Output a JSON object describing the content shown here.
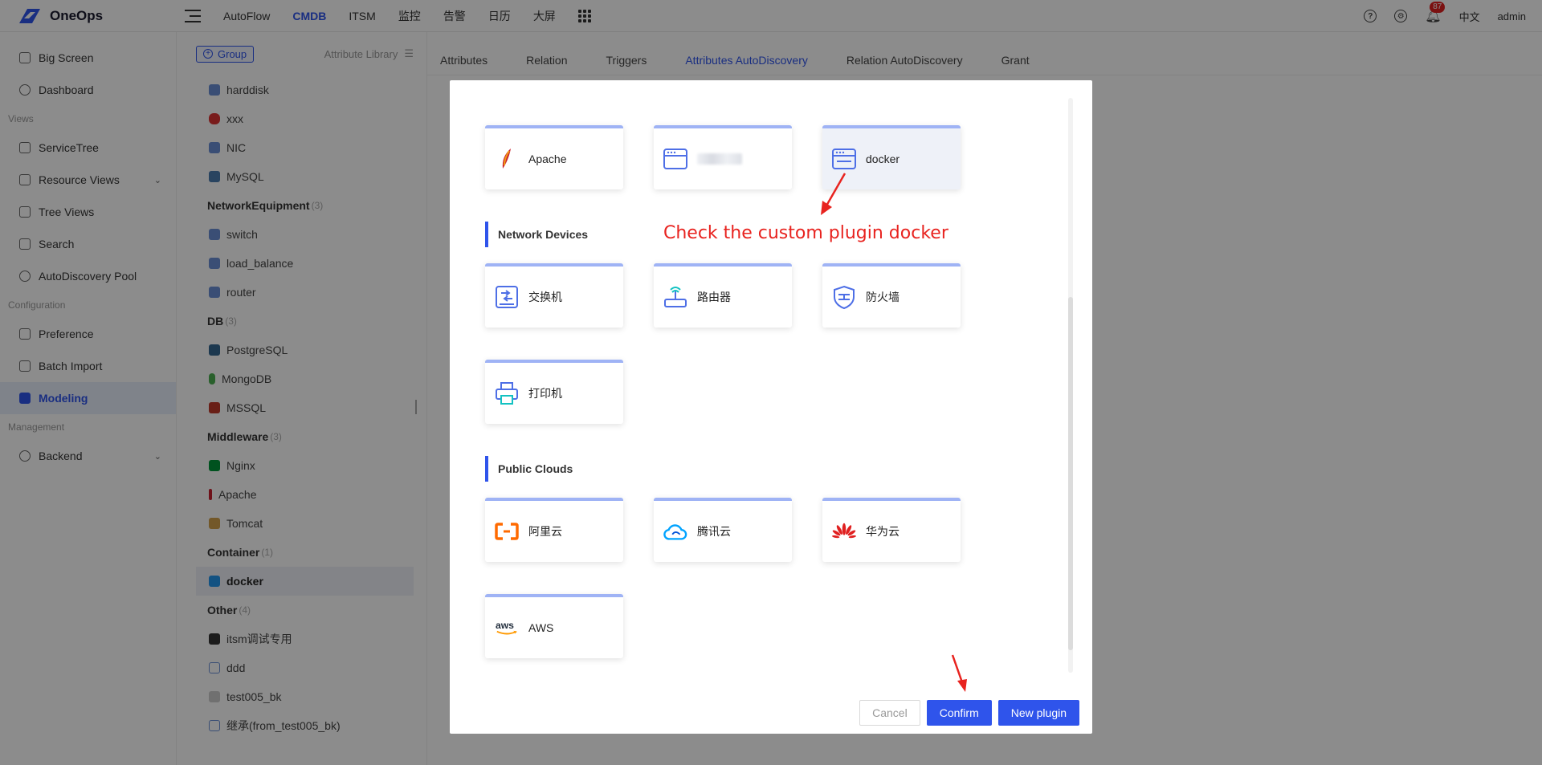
{
  "app": {
    "title": "OneOps"
  },
  "topnav": {
    "items": [
      "AutoFlow",
      "CMDB",
      "ITSM",
      "监控",
      "告警",
      "日历",
      "大屏"
    ],
    "active": "CMDB",
    "notification_count": "87",
    "language": "中文",
    "user": "admin"
  },
  "sidebar": {
    "items": [
      {
        "label": "Big Screen"
      },
      {
        "label": "Dashboard"
      }
    ],
    "group_views": "Views",
    "views_items": [
      {
        "label": "ServiceTree"
      },
      {
        "label": "Resource Views"
      },
      {
        "label": "Tree Views"
      },
      {
        "label": "Search"
      },
      {
        "label": "AutoDiscovery Pool"
      }
    ],
    "group_configuration": "Configuration",
    "config_items": [
      {
        "label": "Preference"
      },
      {
        "label": "Batch Import"
      },
      {
        "label": "Modeling"
      }
    ],
    "group_management": "Management",
    "management_items": [
      {
        "label": "Backend"
      }
    ]
  },
  "models": {
    "group_button": "Group",
    "attribute_library": "Attribute Library",
    "top_items": [
      "harddisk",
      "xxx",
      "NIC",
      "MySQL"
    ],
    "groups": [
      {
        "name": "NetworkEquipment",
        "count": "(3)",
        "items": [
          "switch",
          "load_balance",
          "router"
        ]
      },
      {
        "name": "DB",
        "count": "(3)",
        "items": [
          "PostgreSQL",
          "MongoDB",
          "MSSQL"
        ]
      },
      {
        "name": "Middleware",
        "count": "(3)",
        "items": [
          "Nginx",
          "Apache",
          "Tomcat"
        ]
      },
      {
        "name": "Container",
        "count": "(1)",
        "items": [
          "docker"
        ]
      },
      {
        "name": "Other",
        "count": "(4)",
        "items": [
          "itsm调试专用",
          "ddd",
          "test005_bk",
          "继承(from_test005_bk)"
        ]
      }
    ],
    "active": "docker"
  },
  "tabs": [
    "Attributes",
    "Relation",
    "Triggers",
    "Attributes AutoDiscovery",
    "Relation AutoDiscovery",
    "Grant"
  ],
  "active_tab": "Attributes AutoDiscovery",
  "modal": {
    "row1": [
      {
        "label": "Apache",
        "icon": "apache-feather-icon"
      },
      {
        "label": "",
        "icon": "server-icon",
        "blurred": true
      },
      {
        "label": "docker",
        "icon": "server-icon",
        "selected": true
      }
    ],
    "section_network": "Network Devices",
    "network": [
      {
        "label": "交换机",
        "icon": "switch-icon"
      },
      {
        "label": "路由器",
        "icon": "router-icon"
      },
      {
        "label": "防火墙",
        "icon": "firewall-icon"
      },
      {
        "label": "打印机",
        "icon": "printer-icon"
      }
    ],
    "section_clouds": "Public Clouds",
    "clouds": [
      {
        "label": "阿里云",
        "icon": "aliyun-icon"
      },
      {
        "label": "腾讯云",
        "icon": "tencent-cloud-icon"
      },
      {
        "label": "华为云",
        "icon": "huawei-icon"
      },
      {
        "label": "AWS",
        "icon": "aws-icon"
      }
    ],
    "annotation": "Check the custom plugin docker",
    "buttons": {
      "cancel": "Cancel",
      "confirm": "Confirm",
      "new_plugin": "New plugin"
    }
  },
  "colors": {
    "primary": "#2f54eb",
    "annotation": "#e8231f",
    "card_top": "#9fb3f5"
  }
}
